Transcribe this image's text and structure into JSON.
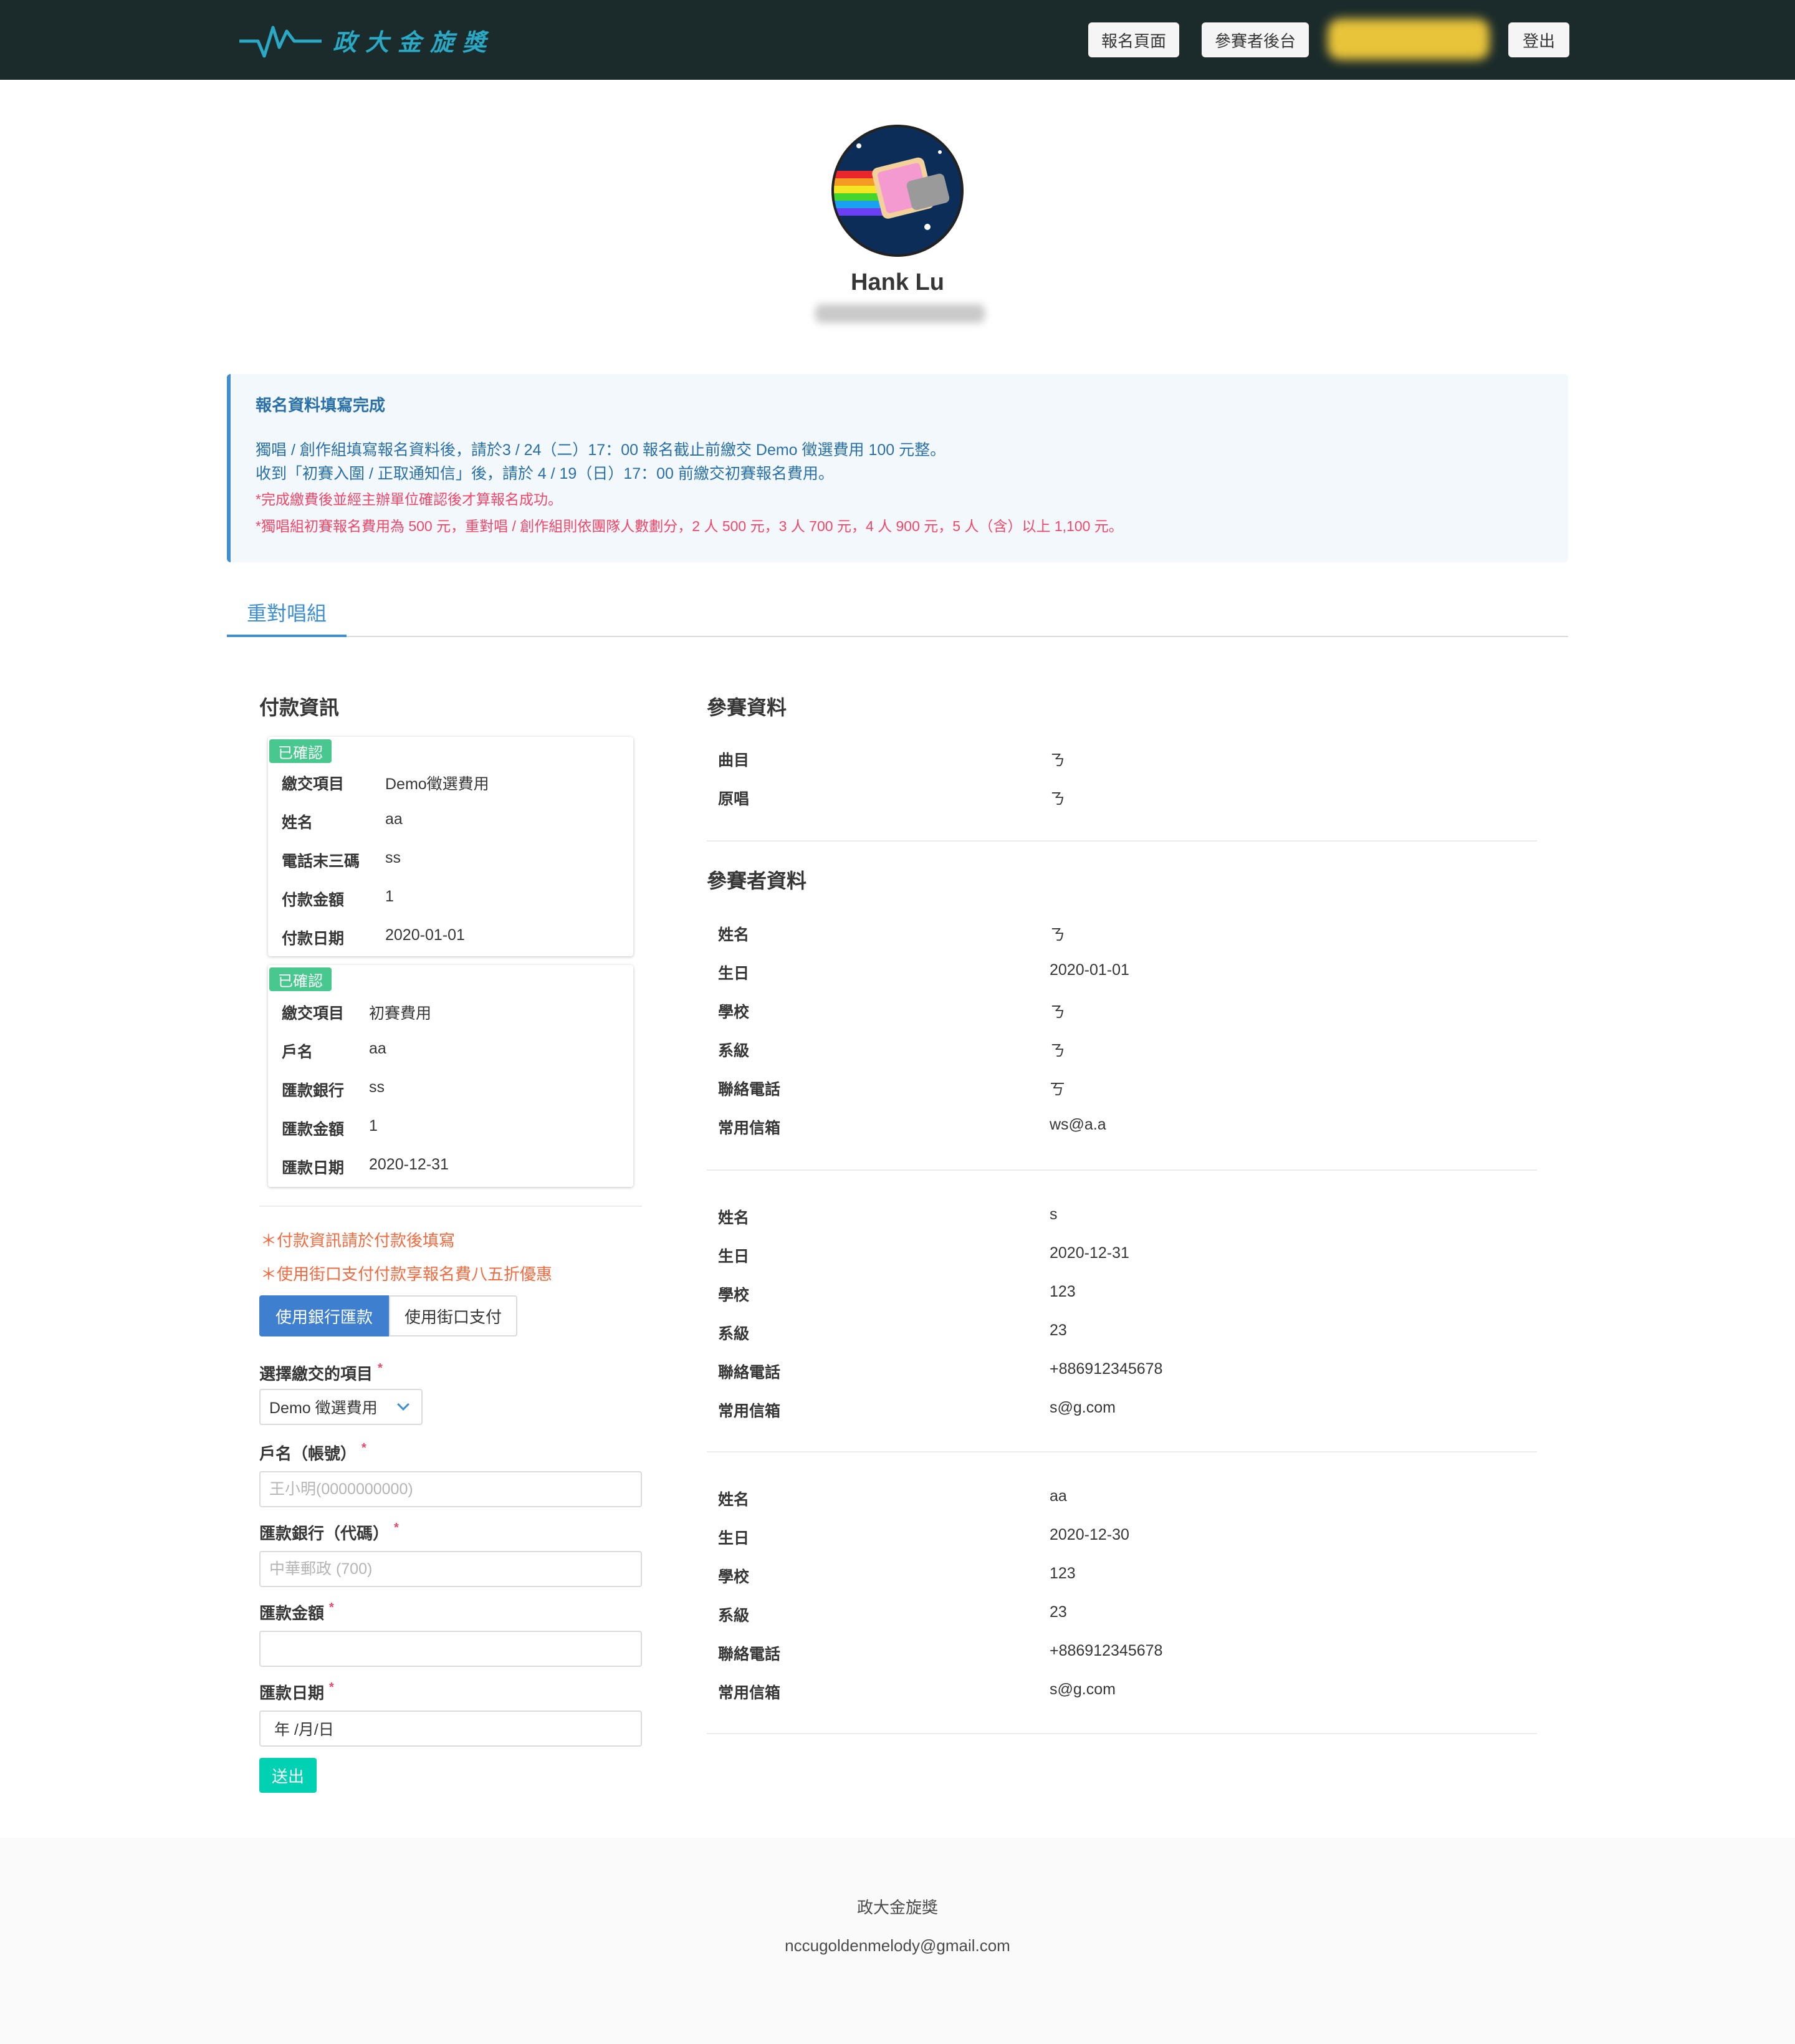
{
  "nav": {
    "brand": "政大金旋獎",
    "signup_label": "報名頁面",
    "backend_label": "參賽者後台",
    "logout_label": "登出"
  },
  "profile": {
    "name": "Hank Lu"
  },
  "notice": {
    "title": "報名資料填寫完成",
    "line1": "獨唱 / 創作組填寫報名資料後，請於3 / 24（二）17：00 報名截止前繳交 Demo 徵選費用 100 元整。",
    "line2": "收到「初賽入圍 / 正取通知信」後，請於 4 / 19（日）17：00 前繳交初賽報名費用。",
    "red1": "*完成繳費後並經主辦單位確認後才算報名成功。",
    "red2": "*獨唱組初賽報名費用為 500 元，重對唱 / 創作組則依團隊人數劃分，2 人 500 元，3 人 700 元，4 人 900 元，5 人（含）以上 1,100 元。"
  },
  "tab": {
    "label": "重對唱組"
  },
  "payment": {
    "title": "付款資訊",
    "cards": [
      {
        "tag": "已確認",
        "rows": [
          {
            "key": "繳交項目",
            "value": "Demo徵選費用"
          },
          {
            "key": "姓名",
            "value": "aa"
          },
          {
            "key": "電話末三碼",
            "value": "ss"
          },
          {
            "key": "付款金額",
            "value": "1"
          },
          {
            "key": "付款日期",
            "value": "2020-01-01"
          }
        ]
      },
      {
        "tag": "已確認",
        "rows": [
          {
            "key": "繳交項目",
            "value": "初賽費用"
          },
          {
            "key": "戶名",
            "value": "aa"
          },
          {
            "key": "匯款銀行",
            "value": "ss"
          },
          {
            "key": "匯款金額",
            "value": "1"
          },
          {
            "key": "匯款日期",
            "value": "2020-12-31"
          }
        ]
      }
    ],
    "hint1": "＊付款資訊請於付款後填寫",
    "hint2": "＊使用街口支付付款享報名費八五折優惠",
    "method_bank": "使用銀行匯款",
    "method_street": "使用街口支付"
  },
  "form": {
    "item_label": "選擇繳交的項目",
    "item_value": "Demo 徵選費用",
    "account_label": "戶名（帳號）",
    "account_placeholder": "王小明(0000000000)",
    "bank_label": "匯款銀行（代碼）",
    "bank_placeholder": "中華郵政 (700)",
    "amount_label": "匯款金額",
    "amount_value": "",
    "date_label": "匯款日期",
    "date_value": "年 /月/日",
    "submit_label": "送出",
    "required_mark": "*"
  },
  "entry": {
    "title": "參賽資料",
    "song_key": "曲目",
    "song_value": "ㄋ",
    "original_key": "原唱",
    "original_value": "ㄋ"
  },
  "participants": {
    "title": "參賽者資料",
    "labels": {
      "name": "姓名",
      "birthday": "生日",
      "school": "學校",
      "department": "系級",
      "phone": "聯絡電話",
      "email": "常用信箱"
    },
    "people": [
      {
        "name": "ㄋ",
        "birthday": "2020-01-01",
        "school": "ㄋ",
        "department": "ㄋ",
        "phone": "ㄎ",
        "email": "ws@a.a"
      },
      {
        "name": "s",
        "birthday": "2020-12-31",
        "school": "123",
        "department": "23",
        "phone": "+886912345678",
        "email": "s@g.com"
      },
      {
        "name": "aa",
        "birthday": "2020-12-30",
        "school": "123",
        "department": "23",
        "phone": "+886912345678",
        "email": "s@g.com"
      }
    ]
  },
  "footer": {
    "name": "政大金旋獎",
    "email": "nccugoldenmelody@gmail.com"
  },
  "colors": {
    "navbar": "#1b2b2b",
    "brand": "#2aa8c4",
    "info_blue": "#296fa8",
    "danger": "#f14668",
    "success": "#48c78e",
    "primary": "#3e7fd0",
    "turquoise": "#00d1b2",
    "hint_orange": "#f26a3f"
  }
}
